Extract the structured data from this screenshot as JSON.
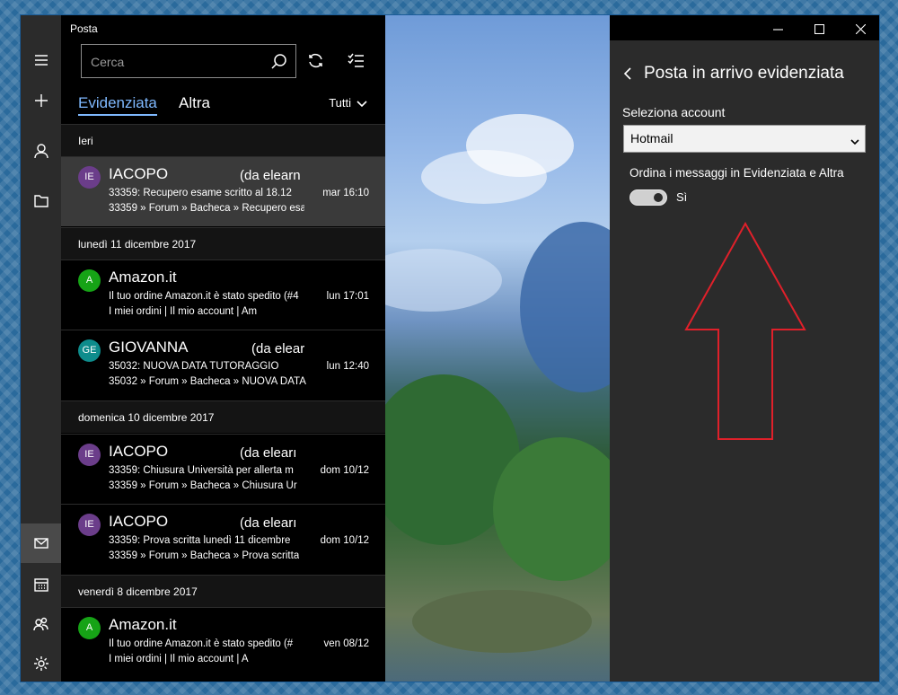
{
  "app": {
    "title": "Posta"
  },
  "search": {
    "placeholder": "Cerca"
  },
  "tabs": {
    "focused": "Evidenziata",
    "other": "Altra"
  },
  "filter": {
    "label": "Tutti"
  },
  "groups": {
    "g1": "Ieri",
    "g2": "lunedì 11 dicembre 2017",
    "g3": "domenica 10 dicembre 2017",
    "g4": "venerdì 8 dicembre 2017"
  },
  "messages": [
    {
      "initials": "IE",
      "avatar_color": "#6b3d8a",
      "sender": "IACOPO",
      "from": "(da elearn",
      "subject": "33359: Recupero esame scritto al 18.12",
      "date": "mar 16:10",
      "preview": "33359 » Forum » Bacheca » Recupero esa"
    },
    {
      "initials": "A",
      "avatar_color": "#16a316",
      "sender": "Amazon.it",
      "from": "",
      "subject": "Il tuo ordine Amazon.it è stato spedito (#4",
      "date": "lun 17:01",
      "preview": "I miei ordini    |    Il mio account    |    Am"
    },
    {
      "initials": "GE",
      "avatar_color": "#0e8c8c",
      "sender": "GIOVANNA",
      "from": "(da elear",
      "subject": "35032: NUOVA DATA TUTORAGGIO",
      "date": "lun 12:40",
      "preview": "35032 » Forum » Bacheca » NUOVA DATA"
    },
    {
      "initials": "IE",
      "avatar_color": "#6b3d8a",
      "sender": "IACOPO",
      "from": "(da elearı",
      "subject": "33359: Chiusura Università per allerta m",
      "date": "dom 10/12",
      "preview": "33359 » Forum » Bacheca » Chiusura Ur"
    },
    {
      "initials": "IE",
      "avatar_color": "#6b3d8a",
      "sender": "IACOPO",
      "from": "(da elearı",
      "subject": "33359: Prova scritta lunedì 11 dicembre",
      "date": "dom 10/12",
      "preview": "33359 » Forum » Bacheca » Prova scritta"
    },
    {
      "initials": "A",
      "avatar_color": "#16a316",
      "sender": "Amazon.it",
      "from": "",
      "subject": "Il tuo ordine Amazon.it è stato spedito (#",
      "date": "ven 08/12",
      "preview": "I miei ordini    |    Il mio account    |    A"
    }
  ],
  "settings": {
    "title": "Posta in arrivo evidenziata",
    "account_label": "Seleziona account",
    "account_value": "Hotmail",
    "order_label": "Ordina i messaggi in Evidenziata e Altra",
    "toggle_label": "Sì",
    "toggle_on": true
  },
  "colors": {
    "accent": "#7fb9ff",
    "annotation_arrow": "#e0202a"
  }
}
